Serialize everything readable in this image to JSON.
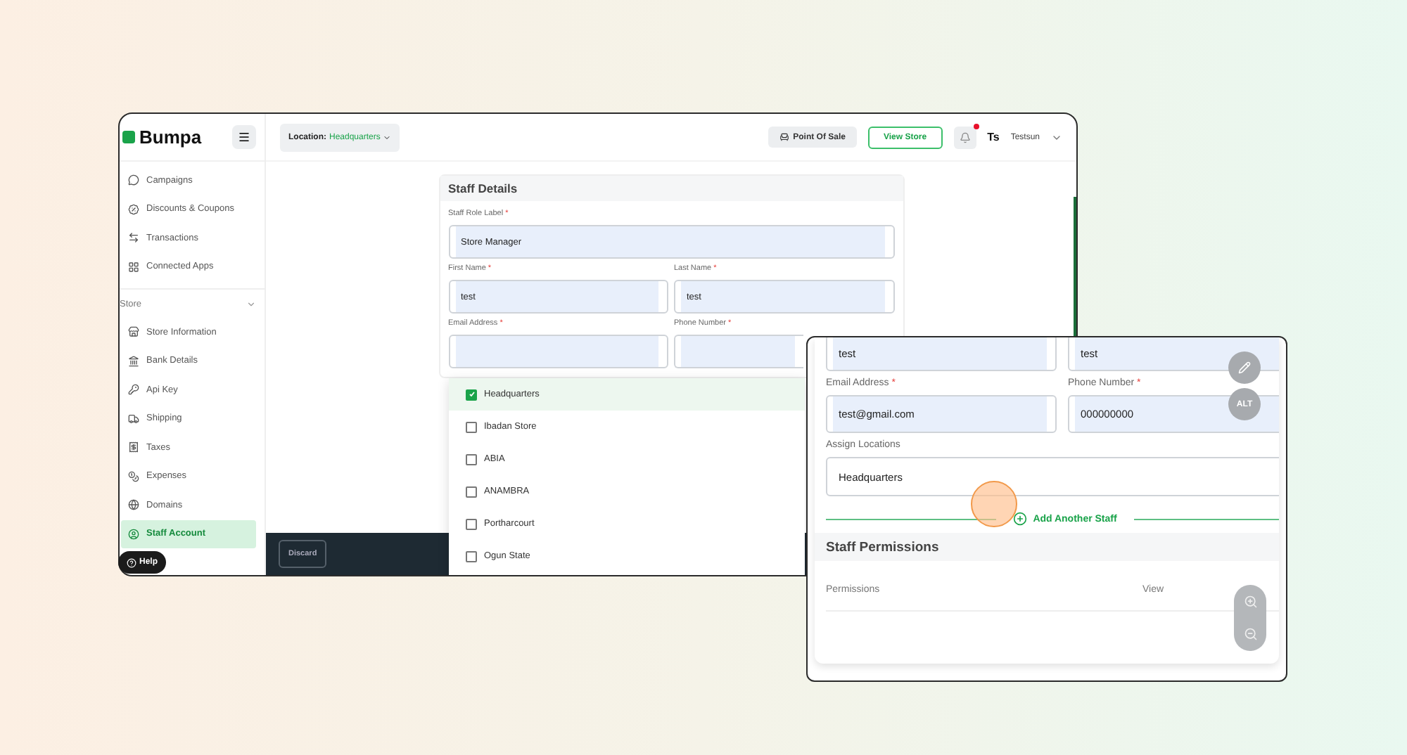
{
  "app": {
    "logo": "Bumpa",
    "location_label": "Location:",
    "location_value": "Headquarters"
  },
  "topbar": {
    "pos_button": "Point Of Sale",
    "view_store_button": "View Store",
    "notification_badge": true,
    "user_initials": "Ts",
    "user_name": "Testsun"
  },
  "sidebar": {
    "items": [
      {
        "label": "Campaigns",
        "selected": false
      },
      {
        "label": "Discounts & Coupons",
        "selected": false
      },
      {
        "label": "Transactions",
        "selected": false
      },
      {
        "label": "Connected Apps",
        "selected": false
      }
    ],
    "section": {
      "title": "Store",
      "expanded": true
    },
    "store_items": [
      {
        "label": "Store Information",
        "selected": false
      },
      {
        "label": "Bank Details",
        "selected": false
      },
      {
        "label": "Api Key",
        "selected": false
      },
      {
        "label": "Shipping",
        "selected": false
      },
      {
        "label": "Taxes",
        "selected": false
      },
      {
        "label": "Expenses",
        "selected": false
      },
      {
        "label": "Domains",
        "selected": false
      },
      {
        "label": "Staff Account",
        "selected": true
      }
    ],
    "help_button": "Help"
  },
  "form": {
    "title": "Staff Details",
    "role": {
      "label": "Staff Role Label",
      "mark": "*",
      "value": "Store Manager"
    },
    "first_name": {
      "label": "First Name",
      "mark": "*",
      "value": "test"
    },
    "last_name": {
      "label": "Last Name",
      "mark": "*",
      "value": "test"
    },
    "email": {
      "label": "Email Address",
      "mark": "*"
    },
    "phone": {
      "label": "Phone Number",
      "mark": "*"
    }
  },
  "locations_dropdown": [
    {
      "label": "Headquarters",
      "checked": true
    },
    {
      "label": "Ibadan Store",
      "checked": false
    },
    {
      "label": "ABIA",
      "checked": false
    },
    {
      "label": "ANAMBRA",
      "checked": false
    },
    {
      "label": "Portharcourt",
      "checked": false
    },
    {
      "label": "Ogun State",
      "checked": false
    }
  ],
  "bottom_bar": {
    "discard_button": "Discard"
  },
  "inset": {
    "first_name": "test",
    "last_name": "test",
    "email": {
      "label": "Email Address",
      "mark": "*",
      "value": "test@gmail.com"
    },
    "phone": {
      "label": "Phone Number",
      "mark": "*",
      "value": "000000000"
    },
    "assign": {
      "label": "Assign Locations",
      "value": "Headquarters"
    },
    "add_staff": "Add Another Staff",
    "permissions_title": "Staff Permissions",
    "columns": [
      "Permissions",
      "View"
    ],
    "edit_tool": "ALT"
  }
}
